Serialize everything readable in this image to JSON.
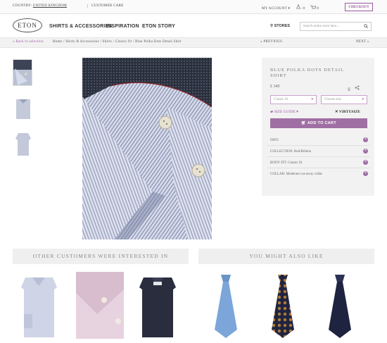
{
  "topbar": {
    "country_label": "COUNTRY:",
    "country_value": "UNITED KINGDOM",
    "customer_care": "CUSTOMER CARE",
    "my_account": "MY ACCOUNT",
    "checkout": "CHECKOUT"
  },
  "nav": {
    "logo": "ETON",
    "items": [
      "SHIRTS & ACCESSORIES",
      "INSPIRATION",
      "ETON STORY"
    ],
    "stores": "STORES",
    "search_placeholder": "Search entire store here..."
  },
  "breadcrumb": {
    "back": "« Back to selection",
    "path": "Home / Shirts & Accessories / Shirts / Classic fit / Blue Polka Dots Detail Shirt",
    "previous": "« PREVIOUS",
    "next": "NEXT »"
  },
  "product": {
    "title": "BLUE POLKA DOTS DETAIL SHIRT",
    "price": "£ 145",
    "fit_select": "Classic fit",
    "size_select": "Choose size",
    "size_guide": "SIZE GUIDE",
    "virtusize": "VIRTUSIZE",
    "add_to_cart": "ADD TO CART",
    "details": [
      "INFO",
      "COLLECTION: Red/Ribbon",
      "BODY FIT: Classic fit",
      "COLLAR: Moderate cut-away collar"
    ]
  },
  "recommendations": {
    "others_heading": "OTHER CUSTOMERS WERE INTERESTED IN",
    "also_like_heading": "YOU MIGHT ALSO LIKE"
  },
  "colors": {
    "accent": "#9b5aa0",
    "panel_bg": "#f2f2f2"
  }
}
